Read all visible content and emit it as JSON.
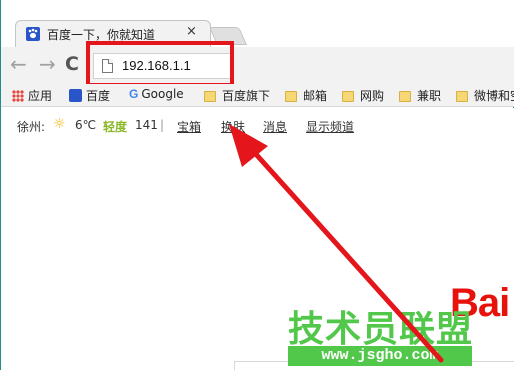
{
  "tab": {
    "title": "百度一下，你就知道",
    "close_glyph": "×",
    "favicon": "baidu-paw-icon"
  },
  "toolbar": {
    "back_glyph": "←",
    "forward_glyph": "→",
    "reload_glyph": "C",
    "url": "192.168.1.1"
  },
  "bookmarks": [
    {
      "icon": "apps-icon",
      "label": "应用"
    },
    {
      "icon": "baidu-icon",
      "label": "百度"
    },
    {
      "icon": "google-icon",
      "label": "Google"
    },
    {
      "icon": "folder-icon",
      "label": "百度旗下"
    },
    {
      "icon": "folder-icon",
      "label": "邮箱"
    },
    {
      "icon": "folder-icon",
      "label": "网购"
    },
    {
      "icon": "folder-icon",
      "label": "兼职"
    },
    {
      "icon": "folder-icon",
      "label": "微博和空"
    }
  ],
  "weather": {
    "city": "徐州:",
    "temperature": "6℃",
    "air_quality": "轻度",
    "aqi": "141",
    "separator": "|",
    "links": [
      "宝箱",
      "换肤",
      "消息",
      "显示频道"
    ]
  },
  "logo_text": "Bai",
  "watermark": {
    "title": "技术员联盟",
    "url": "www.jsgho.com"
  },
  "colors": {
    "highlight": "#e5161b",
    "watermark_green": "#52c84b",
    "baidu_red": "#e8120c",
    "baidu_blue": "#2a55c9"
  }
}
